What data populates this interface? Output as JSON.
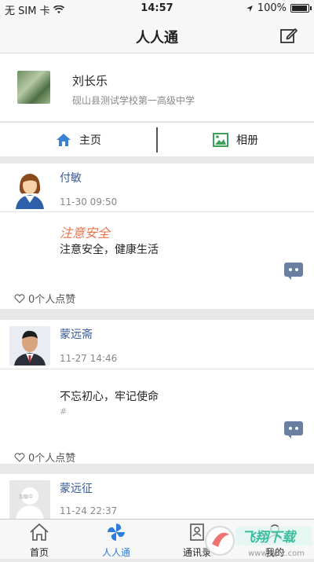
{
  "status": {
    "carrier": "无 SIM 卡",
    "time": "14:57",
    "battery": "100%"
  },
  "nav": {
    "title": "人人通"
  },
  "profile": {
    "name": "刘长乐",
    "school": "砚山县测试学校第一高级中学"
  },
  "tabs": {
    "home": "主页",
    "album": "相册"
  },
  "posts": [
    {
      "author": "付敏",
      "time": "11-30 09:50",
      "title": "注意安全",
      "body": "注意安全，健康生活",
      "likes": "0个人点赞"
    },
    {
      "author": "蒙远斋",
      "time": "11-27 14:46",
      "body": "不忘初心，牢记使命",
      "hash": "#",
      "likes": "0个人点赞"
    },
    {
      "author": "蒙远征",
      "time": "11-24 22:37",
      "avatar_text": "加载中"
    }
  ],
  "tabbar": {
    "home": "首页",
    "renrentong": "人人通",
    "contacts": "通讯录",
    "me": "我的"
  },
  "watermark": {
    "brand": "飞翔下载",
    "url": "www.fxxz.com"
  },
  "colors": {
    "accent": "#2d7de0",
    "link": "#3a5a9a",
    "highlight": "#e8734a"
  }
}
